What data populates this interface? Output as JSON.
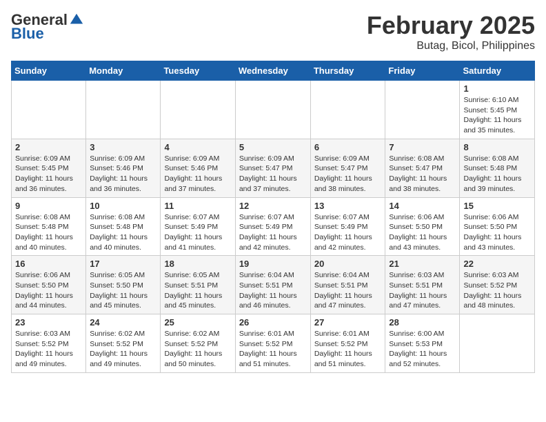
{
  "header": {
    "logo_general": "General",
    "logo_blue": "Blue",
    "title": "February 2025",
    "location": "Butag, Bicol, Philippines"
  },
  "days_of_week": [
    "Sunday",
    "Monday",
    "Tuesday",
    "Wednesday",
    "Thursday",
    "Friday",
    "Saturday"
  ],
  "weeks": [
    {
      "row": 1,
      "days": [
        {
          "date": "",
          "info": ""
        },
        {
          "date": "",
          "info": ""
        },
        {
          "date": "",
          "info": ""
        },
        {
          "date": "",
          "info": ""
        },
        {
          "date": "",
          "info": ""
        },
        {
          "date": "",
          "info": ""
        },
        {
          "date": "1",
          "info": "Sunrise: 6:10 AM\nSunset: 5:45 PM\nDaylight: 11 hours\nand 35 minutes."
        }
      ]
    },
    {
      "row": 2,
      "days": [
        {
          "date": "2",
          "info": "Sunrise: 6:09 AM\nSunset: 5:45 PM\nDaylight: 11 hours\nand 36 minutes."
        },
        {
          "date": "3",
          "info": "Sunrise: 6:09 AM\nSunset: 5:46 PM\nDaylight: 11 hours\nand 36 minutes."
        },
        {
          "date": "4",
          "info": "Sunrise: 6:09 AM\nSunset: 5:46 PM\nDaylight: 11 hours\nand 37 minutes."
        },
        {
          "date": "5",
          "info": "Sunrise: 6:09 AM\nSunset: 5:47 PM\nDaylight: 11 hours\nand 37 minutes."
        },
        {
          "date": "6",
          "info": "Sunrise: 6:09 AM\nSunset: 5:47 PM\nDaylight: 11 hours\nand 38 minutes."
        },
        {
          "date": "7",
          "info": "Sunrise: 6:08 AM\nSunset: 5:47 PM\nDaylight: 11 hours\nand 38 minutes."
        },
        {
          "date": "8",
          "info": "Sunrise: 6:08 AM\nSunset: 5:48 PM\nDaylight: 11 hours\nand 39 minutes."
        }
      ]
    },
    {
      "row": 3,
      "days": [
        {
          "date": "9",
          "info": "Sunrise: 6:08 AM\nSunset: 5:48 PM\nDaylight: 11 hours\nand 40 minutes."
        },
        {
          "date": "10",
          "info": "Sunrise: 6:08 AM\nSunset: 5:48 PM\nDaylight: 11 hours\nand 40 minutes."
        },
        {
          "date": "11",
          "info": "Sunrise: 6:07 AM\nSunset: 5:49 PM\nDaylight: 11 hours\nand 41 minutes."
        },
        {
          "date": "12",
          "info": "Sunrise: 6:07 AM\nSunset: 5:49 PM\nDaylight: 11 hours\nand 42 minutes."
        },
        {
          "date": "13",
          "info": "Sunrise: 6:07 AM\nSunset: 5:49 PM\nDaylight: 11 hours\nand 42 minutes."
        },
        {
          "date": "14",
          "info": "Sunrise: 6:06 AM\nSunset: 5:50 PM\nDaylight: 11 hours\nand 43 minutes."
        },
        {
          "date": "15",
          "info": "Sunrise: 6:06 AM\nSunset: 5:50 PM\nDaylight: 11 hours\nand 43 minutes."
        }
      ]
    },
    {
      "row": 4,
      "days": [
        {
          "date": "16",
          "info": "Sunrise: 6:06 AM\nSunset: 5:50 PM\nDaylight: 11 hours\nand 44 minutes."
        },
        {
          "date": "17",
          "info": "Sunrise: 6:05 AM\nSunset: 5:50 PM\nDaylight: 11 hours\nand 45 minutes."
        },
        {
          "date": "18",
          "info": "Sunrise: 6:05 AM\nSunset: 5:51 PM\nDaylight: 11 hours\nand 45 minutes."
        },
        {
          "date": "19",
          "info": "Sunrise: 6:04 AM\nSunset: 5:51 PM\nDaylight: 11 hours\nand 46 minutes."
        },
        {
          "date": "20",
          "info": "Sunrise: 6:04 AM\nSunset: 5:51 PM\nDaylight: 11 hours\nand 47 minutes."
        },
        {
          "date": "21",
          "info": "Sunrise: 6:03 AM\nSunset: 5:51 PM\nDaylight: 11 hours\nand 47 minutes."
        },
        {
          "date": "22",
          "info": "Sunrise: 6:03 AM\nSunset: 5:52 PM\nDaylight: 11 hours\nand 48 minutes."
        }
      ]
    },
    {
      "row": 5,
      "days": [
        {
          "date": "23",
          "info": "Sunrise: 6:03 AM\nSunset: 5:52 PM\nDaylight: 11 hours\nand 49 minutes."
        },
        {
          "date": "24",
          "info": "Sunrise: 6:02 AM\nSunset: 5:52 PM\nDaylight: 11 hours\nand 49 minutes."
        },
        {
          "date": "25",
          "info": "Sunrise: 6:02 AM\nSunset: 5:52 PM\nDaylight: 11 hours\nand 50 minutes."
        },
        {
          "date": "26",
          "info": "Sunrise: 6:01 AM\nSunset: 5:52 PM\nDaylight: 11 hours\nand 51 minutes."
        },
        {
          "date": "27",
          "info": "Sunrise: 6:01 AM\nSunset: 5:52 PM\nDaylight: 11 hours\nand 51 minutes."
        },
        {
          "date": "28",
          "info": "Sunrise: 6:00 AM\nSunset: 5:53 PM\nDaylight: 11 hours\nand 52 minutes."
        },
        {
          "date": "",
          "info": ""
        }
      ]
    }
  ]
}
